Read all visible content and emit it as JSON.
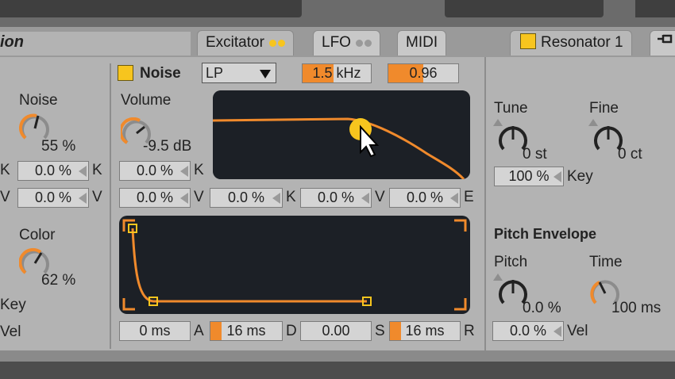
{
  "header": {
    "title": "ion",
    "tabs": [
      {
        "label": "Excitator"
      },
      {
        "label": "LFO"
      },
      {
        "label": "MIDI"
      }
    ],
    "resonator_tab": "Resonator 1",
    "pin_icon": "pin-icon"
  },
  "colors": {
    "accent": "#f08a2c",
    "indicator": "#f7c51e",
    "display_bg": "#1c2026"
  },
  "left_column": {
    "noise_label": "Noise",
    "noise_value": "55 %",
    "row1": {
      "field": "0.0 %",
      "left_tag": "K",
      "right_tag": "K"
    },
    "row2": {
      "field": "0.0 %",
      "left_tag": "V",
      "right_tag": "V"
    },
    "color_label": "Color",
    "color_value": "62 %",
    "key_label": "Key",
    "vel_label": "Vel"
  },
  "noise_section": {
    "toggle_label": "Noise",
    "filter_type": "LP",
    "freq": "1.5 kHz",
    "freq_level": 0.45,
    "res": "0.96",
    "res_level": 0.5,
    "volume_label": "Volume",
    "volume_value": "-9.5 dB",
    "vol_key_field": "0.0 %",
    "vol_key_tag": "K",
    "mod_row": [
      {
        "value": "0.0 %",
        "tag": "V"
      },
      {
        "value": "0.0 %",
        "tag": "K"
      },
      {
        "value": "0.0 %",
        "tag": "V"
      },
      {
        "value": "0.0 %",
        "tag": "E"
      }
    ],
    "envelope": {
      "attack": "0 ms",
      "attack_tag": "A",
      "decay": "16 ms",
      "decay_tag": "D",
      "sustain": "0.00",
      "sustain_tag": "S",
      "release": "16 ms",
      "release_tag": "R"
    }
  },
  "resonator": {
    "tune_label": "Tune",
    "tune_value": "0 st",
    "fine_label": "Fine",
    "fine_value": "0 ct",
    "key_field": "100 %",
    "key_tag": "Key",
    "pitch_env_title": "Pitch Envelope",
    "pitch_label": "Pitch",
    "pitch_value": "0.0 %",
    "time_label": "Time",
    "time_value": "100 ms",
    "vel_field": "0.0 %",
    "vel_tag": "Vel"
  }
}
